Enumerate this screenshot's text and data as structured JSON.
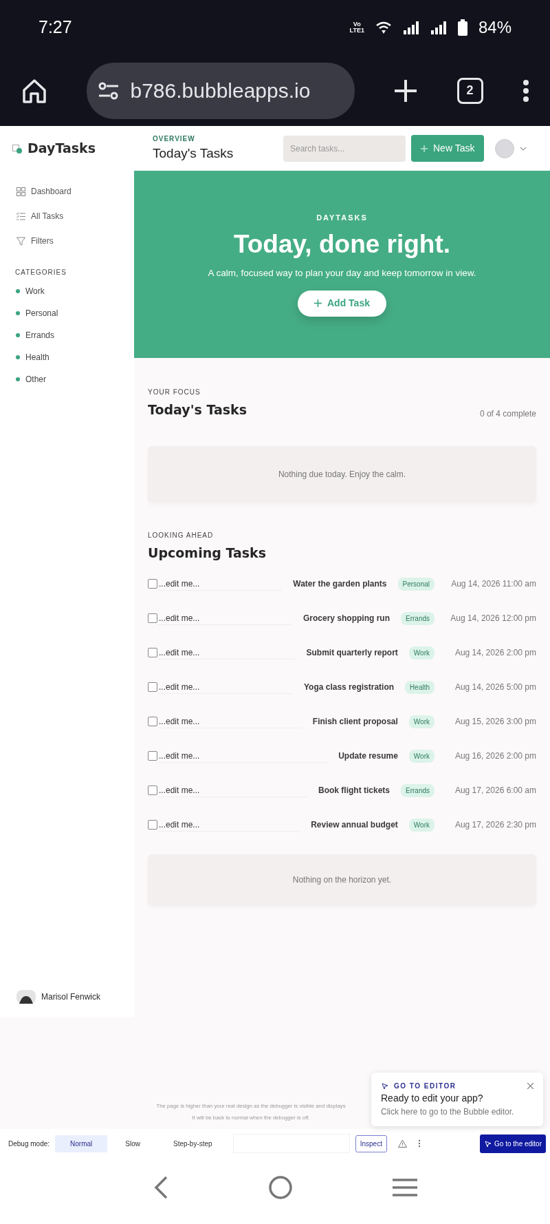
{
  "status_bar": {
    "time": "7:27",
    "network": [
      "Vo",
      "LTE1"
    ],
    "battery": "84%"
  },
  "browser": {
    "url": "b786.bubbleapps.io",
    "tab_count": "2"
  },
  "header": {
    "eyebrow": "OVERVIEW",
    "title": "Today's Tasks",
    "search": {
      "placeholder": "Search tasks..."
    },
    "new_button": "New Task"
  },
  "sidebar": {
    "brand": "DayTasks",
    "nav": [
      {
        "label": "Dashboard",
        "kind": "grid"
      },
      {
        "label": "All Tasks",
        "kind": "list"
      },
      {
        "label": "Filters",
        "kind": "filter"
      }
    ],
    "categories_title": "CATEGORIES",
    "categories": [
      {
        "label": "Work"
      },
      {
        "label": "Personal"
      },
      {
        "label": "Errands"
      },
      {
        "label": "Health"
      },
      {
        "label": "Other"
      }
    ],
    "user": "Marisol Fenwick"
  },
  "hero": {
    "eyebrow": "DAYTASKS",
    "title": "Today, done right.",
    "subtitle": "A calm, focused way to plan your day and keep tomorrow in view.",
    "button": "Add Task"
  },
  "today": {
    "eyebrow": "YOUR FOCUS",
    "title": "Today's Tasks",
    "progress": "0 of 4 complete",
    "empty": "Nothing due today. Enjoy the calm."
  },
  "upcoming": {
    "eyebrow": "LOOKING AHEAD",
    "title": "Upcoming Tasks",
    "tasks": [
      {
        "checked": false,
        "note": "...edit me...",
        "title": "Water the garden plants",
        "tag": "Personal",
        "due": "Aug 14, 2026 11:00 am"
      },
      {
        "checked": false,
        "note": "...edit me...",
        "title": "Grocery shopping run",
        "tag": "Errands",
        "due": "Aug 14, 2026 12:00 pm"
      },
      {
        "checked": false,
        "note": "...edit me...",
        "title": "Submit quarterly report",
        "tag": "Work",
        "due": "Aug 14, 2026 2:00 pm"
      },
      {
        "checked": false,
        "note": "...edit me...",
        "title": "Yoga class registration",
        "tag": "Health",
        "due": "Aug 14, 2026 5:00 pm"
      },
      {
        "checked": false,
        "note": "...edit me...",
        "title": "Finish client proposal",
        "tag": "Work",
        "due": "Aug 15, 2026 3:00 pm"
      },
      {
        "checked": false,
        "note": "...edit me...",
        "title": "Update resume",
        "tag": "Work",
        "due": "Aug 16, 2026 2:00 pm"
      },
      {
        "checked": false,
        "note": "...edit me...",
        "title": "Book flight tickets",
        "tag": "Errands",
        "due": "Aug 17, 2026 6:00 am"
      },
      {
        "checked": false,
        "note": "...edit me...",
        "title": "Review annual budget",
        "tag": "Work",
        "due": "Aug 17, 2026 2:30 pm"
      }
    ],
    "empty": "Nothing on the horizon yet."
  },
  "debugger": {
    "notice": [
      "The page is higher than your real design as the debugger is visible and displays",
      "It will be back to normal when the debugger is off."
    ],
    "label": "Debug mode:",
    "modes": [
      {
        "label": "Normal",
        "selected": true
      },
      {
        "label": "Slow",
        "selected": false
      },
      {
        "label": "Step-by-step",
        "selected": false
      }
    ],
    "inspect": "Inspect",
    "editor_button": "Go to the editor"
  },
  "editor_popup": {
    "eyebrow": "GO TO EDITOR",
    "title": "Ready to edit your app?",
    "text": "Click here to go to the Bubble editor."
  }
}
